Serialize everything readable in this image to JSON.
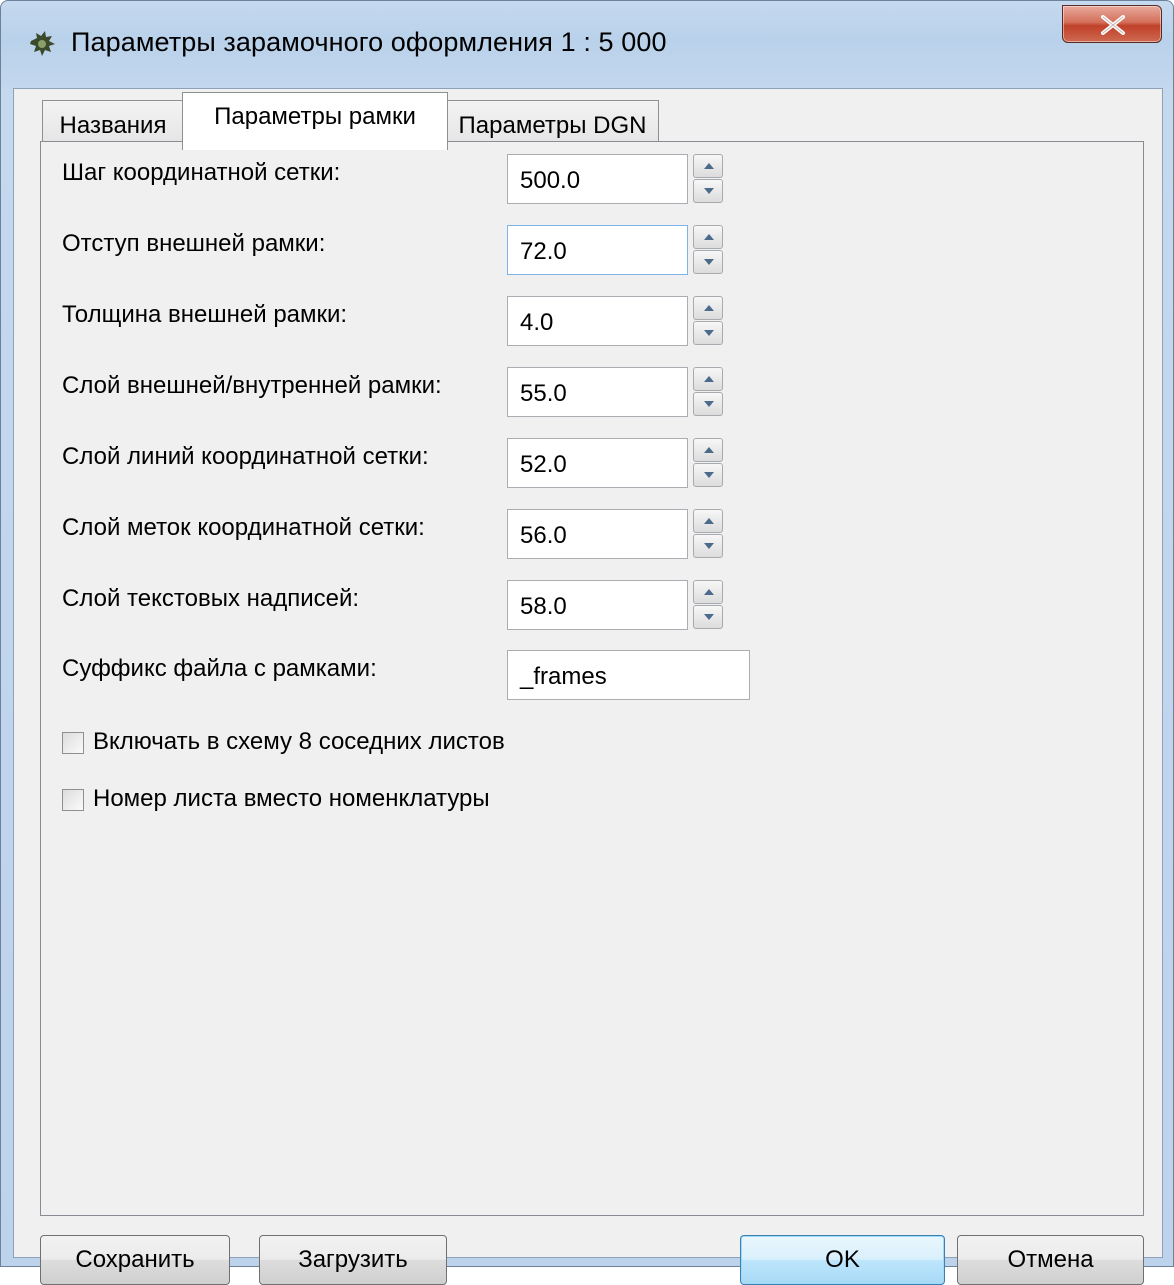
{
  "window": {
    "title": "Параметры зарамочного оформления 1 : 5 000",
    "close_label": "X"
  },
  "tabs": [
    {
      "label": "Названия",
      "active": false
    },
    {
      "label": "Параметры рамки",
      "active": true
    },
    {
      "label": "Параметры DGN",
      "active": false
    }
  ],
  "fields": [
    {
      "label": "Шаг координатной сетки:",
      "value": "500.0"
    },
    {
      "label": "Отступ внешней рамки:",
      "value": "72.0"
    },
    {
      "label": "Толщина внешней рамки:",
      "value": "4.0"
    },
    {
      "label": "Слой внешней/внутренней рамки:",
      "value": "55.0"
    },
    {
      "label": "Слой линий координатной сетки:",
      "value": "52.0"
    },
    {
      "label": "Слой меток координатной сетки:",
      "value": "56.0"
    },
    {
      "label": "Слой текстовых надписей:",
      "value": "58.0"
    },
    {
      "label": "Суффикс файла с рамками:",
      "value": "_frames"
    }
  ],
  "checkboxes": [
    {
      "label": "Включать в схему 8 соседних листов",
      "checked": false
    },
    {
      "label": "Номер листа вместо номенклатуры",
      "checked": false
    }
  ],
  "buttons": {
    "save": "Сохранить",
    "load": "Загрузить",
    "ok": "OK",
    "cancel": "Отмена"
  },
  "colors": {
    "frame": "#bdd3ec",
    "close_button": "#c0412a",
    "default_button_border": "#3c7fb1"
  }
}
